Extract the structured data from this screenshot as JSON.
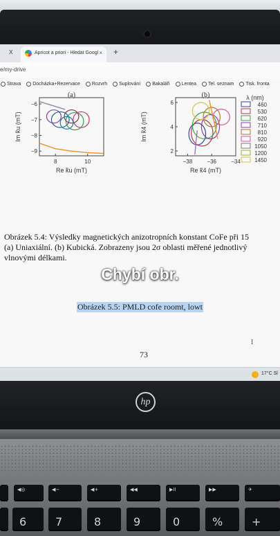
{
  "browser": {
    "tab_close_left": "x",
    "tab_title": "Apricot a priori - Hledat Googl",
    "tab_close": "×",
    "new_tab": "+",
    "url": "e/my-drive",
    "bookmarks": [
      "Strava",
      "Docházka+Rezervace",
      "Rozvrh",
      "Suplování",
      "Bakaláři",
      "Lentea",
      "Tel. seznam",
      "Tisk. fronta"
    ]
  },
  "document": {
    "caption_lines": [
      "Obrázek 5.4: Výsledky magnetických anizotropních konstant CoFe při 15",
      "(a) Uniaxiální. (b) Kubická. Zobrazeny jsou 2σ oblasti měřené jednotlivý",
      "vlnovými délkami."
    ],
    "overlay_text": "Chybí obr.",
    "missing_figure_caption": "Obrázek 5.5: PMLD cofe roomt, lowt",
    "page_number": "73",
    "cursor": "I"
  },
  "taskbar": {
    "weather": "17°C Sl"
  },
  "laptop": {
    "brand": "hp"
  },
  "chart_data": [
    {
      "type": "scatter",
      "title": "(a)",
      "xlabel": "Re k̃u (mT)",
      "ylabel": "Im k̃u (mT)",
      "xticks": [
        "8",
        "10"
      ],
      "yticks": [
        "−6",
        "−7",
        "−8",
        "−9"
      ],
      "xlim": [
        7,
        11
      ],
      "ylim": [
        -9.3,
        -5.6
      ],
      "regions": [
        {
          "x": 7.9,
          "y": -6.8,
          "rx": 0.45,
          "ry": 0.42,
          "color": "#7d4aa0"
        },
        {
          "x": 8.3,
          "y": -7.0,
          "rx": 0.55,
          "ry": 0.5,
          "color": "#2f5da7"
        },
        {
          "x": 9.0,
          "y": -6.8,
          "rx": 0.45,
          "ry": 0.42,
          "color": "#7b3d45"
        },
        {
          "x": 9.2,
          "y": -7.1,
          "rx": 0.55,
          "ry": 0.55,
          "color": "#38994a"
        },
        {
          "x": 9.6,
          "y": -7.0,
          "rx": 0.5,
          "ry": 0.5,
          "color": "#c23c6f"
        },
        {
          "x": 8.7,
          "y": -7.2,
          "rx": 0.4,
          "ry": 0.4,
          "color": "#0e7fa0"
        }
      ],
      "lines": [
        {
          "name": "",
          "color": "#f08f2d",
          "x": [
            7.0,
            8.0,
            9.0,
            10.0,
            11.0
          ],
          "y": [
            -8.5,
            -8.85,
            -9.0,
            -9.1,
            -9.15
          ]
        },
        {
          "name": "",
          "color": "#8f8aa3",
          "x": [
            7.0,
            7.8,
            8.6
          ],
          "y": [
            -5.85,
            -6.1,
            -6.35
          ]
        }
      ]
    },
    {
      "type": "scatter",
      "title": "(b)",
      "xlabel": "Re k̃4 (mT)",
      "ylabel": "Im k̃4 (mT)",
      "xticks": [
        "−38",
        "−36",
        "−34"
      ],
      "yticks": [
        "2",
        "4",
        "6"
      ],
      "xlim": [
        -39,
        -34
      ],
      "ylim": [
        1.6,
        6.4
      ],
      "legend_title": "λ (nm)",
      "legend": [
        {
          "label": "460",
          "color": "#34439a"
        },
        {
          "label": "530",
          "color": "#b13c4a"
        },
        {
          "label": "620",
          "color": "#43a047"
        },
        {
          "label": "710",
          "color": "#8a3fb2"
        },
        {
          "label": "810",
          "color": "#b97431"
        },
        {
          "label": "920",
          "color": "#d95aa0"
        },
        {
          "label": "1050",
          "color": "#7b7b7b"
        },
        {
          "label": "1200",
          "color": "#9ab83d"
        },
        {
          "label": "1450",
          "color": "#d7c24e"
        }
      ],
      "regions": [
        {
          "x": -37.2,
          "y": 3.4,
          "rx": 0.7,
          "ry": 0.9,
          "color": "#34439a"
        },
        {
          "x": -36.8,
          "y": 3.5,
          "rx": 0.9,
          "ry": 1.1,
          "color": "#b13c4a"
        },
        {
          "x": -36.6,
          "y": 4.1,
          "rx": 1.0,
          "ry": 1.1,
          "color": "#43a047"
        },
        {
          "x": -36.1,
          "y": 4.0,
          "rx": 0.75,
          "ry": 1.0,
          "color": "#8a3fb2"
        },
        {
          "x": -36.0,
          "y": 4.8,
          "rx": 0.7,
          "ry": 0.8,
          "color": "#b97431"
        },
        {
          "x": -35.2,
          "y": 4.8,
          "rx": 0.7,
          "ry": 0.65,
          "color": "#d95aa0"
        },
        {
          "x": -36.9,
          "y": 5.3,
          "rx": 0.7,
          "ry": 0.7,
          "color": "#d7c24e"
        }
      ],
      "lines": [
        {
          "name": "",
          "color": "#f08f2d",
          "x": [
            -36.2,
            -35.8,
            -35.5
          ],
          "y": [
            6.2,
            4.4,
            3.0
          ]
        },
        {
          "name": "",
          "color": "#9b78b6",
          "x": [
            -37.4,
            -37.3,
            -37.2
          ],
          "y": [
            1.7,
            2.8,
            3.7
          ]
        }
      ]
    }
  ]
}
